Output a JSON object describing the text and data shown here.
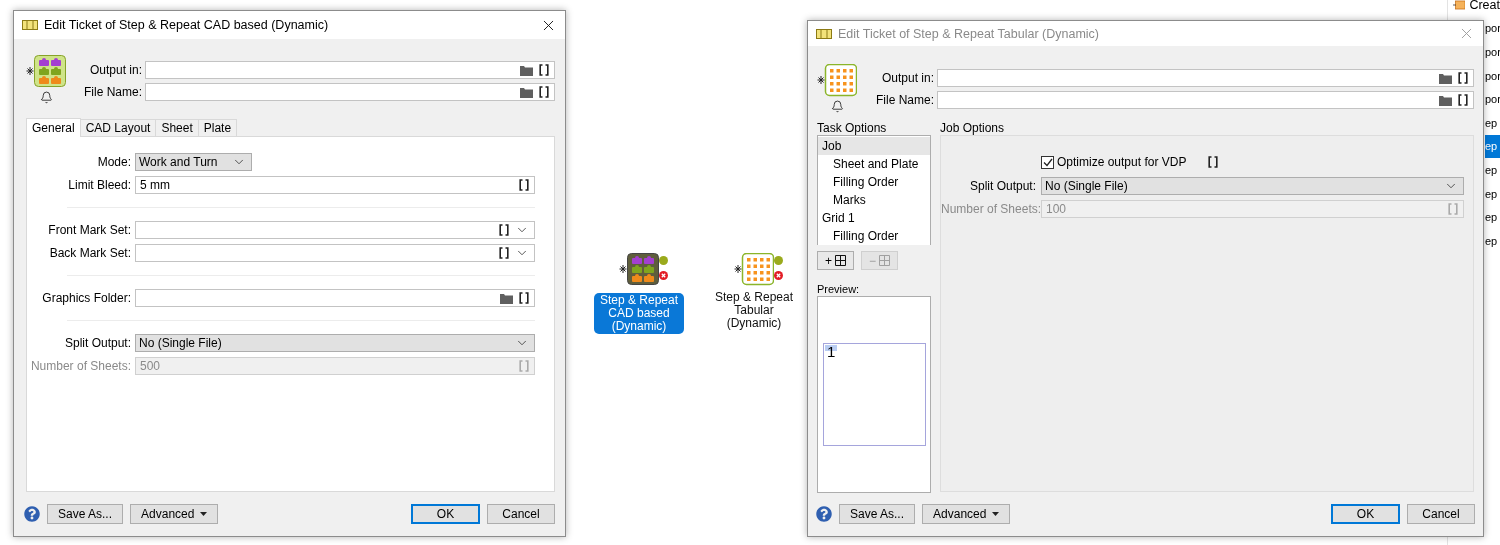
{
  "cad_dialog": {
    "title": "Edit Ticket of Step & Repeat CAD based (Dynamic)",
    "active": true,
    "path_fields": [
      {
        "label": "Output in:"
      },
      {
        "label": "File Name:"
      }
    ],
    "tabs": [
      {
        "label": "General",
        "selected": true
      },
      {
        "label": "CAD Layout",
        "selected": false
      },
      {
        "label": "Sheet",
        "selected": false
      },
      {
        "label": "Plate",
        "selected": false
      }
    ],
    "form": [
      {
        "kind": "short-select",
        "label": "Mode:",
        "value": "Work and Turn",
        "disabled": false
      },
      {
        "kind": "field",
        "label": "Limit Bleed:",
        "value": "5 mm",
        "disabled": false
      },
      {
        "kind": "gap"
      },
      {
        "kind": "mark-set",
        "label": "Front Mark Set:",
        "disabled": false
      },
      {
        "kind": "mark-set",
        "label": "Back Mark Set:",
        "disabled": false
      },
      {
        "kind": "gap"
      },
      {
        "kind": "folder",
        "label": "Graphics Folder:",
        "disabled": false
      },
      {
        "kind": "gap"
      },
      {
        "kind": "select",
        "label": "Split Output:",
        "value": "No (Single File)",
        "disabled": false
      },
      {
        "kind": "field",
        "label": "Number of Sheets:",
        "value": "500",
        "disabled": true
      }
    ],
    "footer": {
      "left": [
        {
          "label": "Save As...",
          "kind": "plain"
        },
        {
          "label": "Advanced",
          "kind": "menu"
        }
      ],
      "right": [
        {
          "label": "OK",
          "kind": "default"
        },
        {
          "label": "Cancel",
          "kind": "plain"
        }
      ]
    }
  },
  "canvas": {
    "nodes": [
      {
        "label": "Step & Repeat\nCAD based\n(Dynamic)",
        "kind": "cad",
        "selected": true
      },
      {
        "label": "Step & Repeat\nTabular\n(Dynamic)",
        "kind": "tabular",
        "selected": false
      }
    ]
  },
  "tabular_dialog": {
    "title": "Edit Ticket of Step & Repeat Tabular (Dynamic)",
    "active": false,
    "path_fields": [
      {
        "label": "Output in:"
      },
      {
        "label": "File Name:"
      }
    ],
    "task_options_title": "Task Options",
    "tasks": [
      {
        "label": "Job",
        "selected": true,
        "children": [
          {
            "label": "Sheet and Plate",
            "selected": false
          },
          {
            "label": "Filling Order",
            "selected": false
          },
          {
            "label": "Marks",
            "selected": false
          }
        ]
      },
      {
        "label": "Grid 1",
        "selected": false,
        "children": [
          {
            "label": "Filling Order",
            "selected": false
          }
        ]
      }
    ],
    "grid_buttons": [
      {
        "label": "+",
        "disabled": false
      },
      {
        "label": "−",
        "disabled": true
      }
    ],
    "preview": {
      "label": "Preview:",
      "page": "1"
    },
    "job_options": {
      "title": "Job Options",
      "checkbox": {
        "label": "Optimize output for VDP",
        "checked": true
      },
      "form": [
        {
          "kind": "select",
          "label": "Split Output:",
          "value": "No (Single File)",
          "disabled": false
        },
        {
          "kind": "field",
          "label": "Number of Sheets:",
          "value": "100",
          "disabled": true
        }
      ]
    },
    "footer": {
      "left": [
        {
          "label": "Save As...",
          "kind": "plain"
        },
        {
          "label": "Advanced",
          "kind": "menu"
        }
      ],
      "right": [
        {
          "label": "OK",
          "kind": "default"
        },
        {
          "label": "Cancel",
          "kind": "plain"
        }
      ]
    }
  },
  "side_list": {
    "items": [
      {
        "label": "Creat",
        "kind": "icon",
        "selected": false
      },
      {
        "label": "por",
        "kind": "plain",
        "selected": false
      },
      {
        "label": "por",
        "kind": "plain",
        "selected": false
      },
      {
        "label": "por",
        "kind": "plain",
        "selected": false
      },
      {
        "label": "por",
        "kind": "plain",
        "selected": false
      },
      {
        "label": "ep",
        "kind": "plain",
        "selected": false
      },
      {
        "label": "ep",
        "kind": "plain",
        "selected": true
      },
      {
        "label": "ep",
        "kind": "plain",
        "selected": false
      },
      {
        "label": "ep",
        "kind": "plain",
        "selected": false
      },
      {
        "label": "ep",
        "kind": "plain",
        "selected": false
      },
      {
        "label": "ep",
        "kind": "plain",
        "selected": false
      }
    ]
  }
}
